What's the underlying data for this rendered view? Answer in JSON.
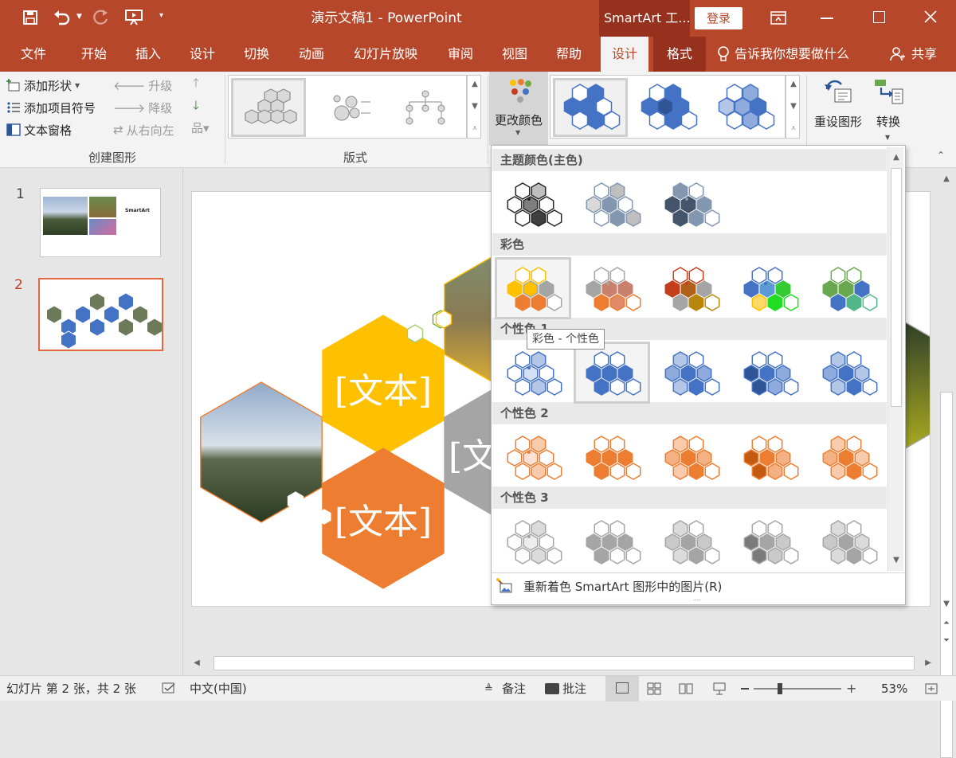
{
  "window": {
    "title": "演示文稿1  -  PowerPoint",
    "contextual_tab_group": "SmartArt 工...",
    "login_label": "登录"
  },
  "menu": {
    "items": [
      "文件",
      "开始",
      "插入",
      "设计",
      "切换",
      "动画",
      "幻灯片放映",
      "审阅",
      "视图",
      "帮助",
      "设计",
      "格式"
    ],
    "tell_me": "告诉我你想要做什么",
    "share": "共享"
  },
  "ribbon": {
    "create_graphic": {
      "add_shape": "添加形状",
      "add_bullet": "添加项目符号",
      "text_pane": "文本窗格",
      "promote": "升级",
      "demote": "降级",
      "right_to_left": "从右向左",
      "label": "创建图形"
    },
    "layouts_label": "版式",
    "change_colors": "更改颜色",
    "reset_graphic": "重设图形",
    "convert": "转换"
  },
  "slides": {
    "items": [
      {
        "number": "1",
        "thumb_title": "SmartArt"
      },
      {
        "number": "2"
      }
    ]
  },
  "canvas": {
    "placeholder_texts": [
      "[文本]",
      "[文本]",
      "[文"
    ]
  },
  "colors_dropdown": {
    "sections": [
      {
        "title": "主题颜色(主色)",
        "variants": 3
      },
      {
        "title": "彩色",
        "variants": 5
      },
      {
        "title": "个性色 1",
        "variants": 5
      },
      {
        "title": "个性色 2",
        "variants": 5
      },
      {
        "title": "个性色 3",
        "variants": 5
      }
    ],
    "tooltip": "彩色 - 个性色",
    "recolor_pictures": "重新着色 SmartArt 图形中的图片(R)"
  },
  "status": {
    "slide_info": "幻灯片 第 2 张，共 2 张",
    "language": "中文(中国)",
    "notes": "备注",
    "comments": "批注",
    "zoom": "53%"
  },
  "palette": {
    "title_bar": "#b7472a",
    "contextual_tab": "#95311d",
    "accent_orange": "#c43e1c",
    "hex_yellow": "#ffc000",
    "hex_orange": "#ed7d31",
    "hex_gray": "#a5a5a5",
    "hex_blue": "#4472c4"
  }
}
